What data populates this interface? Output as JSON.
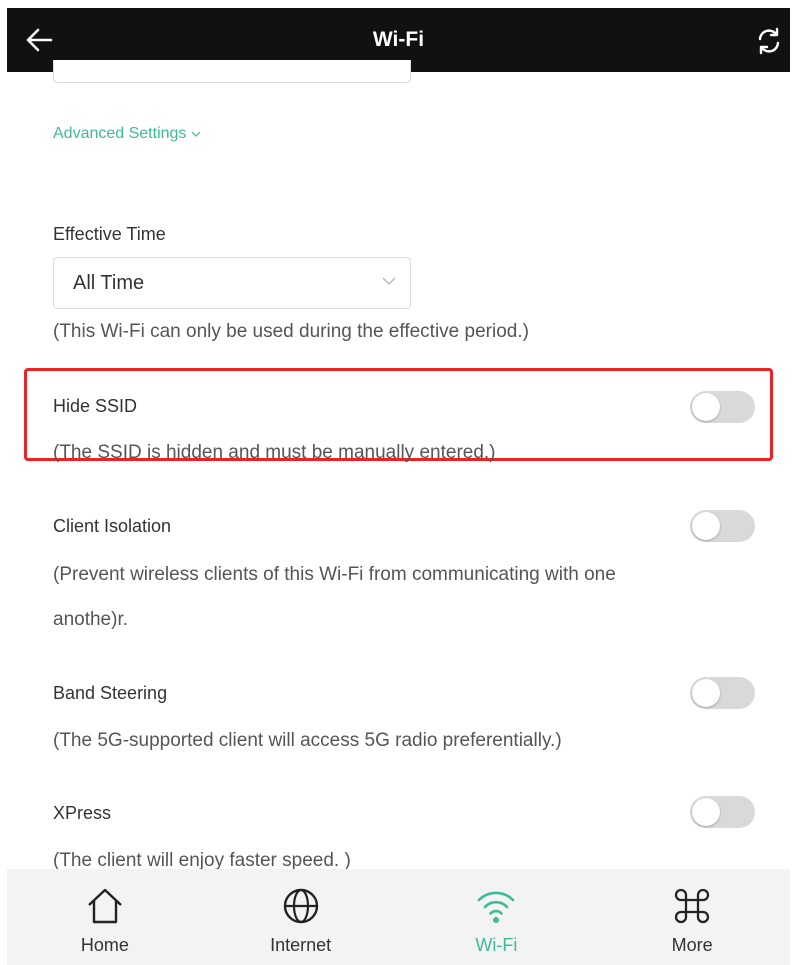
{
  "header": {
    "title": "Wi-Fi",
    "back_icon": "arrow-left-icon",
    "refresh_icon": "refresh-icon",
    "background": "#111111"
  },
  "advanced_settings": {
    "label": "Advanced Settings",
    "color": "#3fba98"
  },
  "effective_time": {
    "label": "Effective Time",
    "selected": "All Time",
    "description": "(This Wi-Fi can only be used during the effective period.)"
  },
  "settings": {
    "hide_ssid": {
      "label": "Hide SSID",
      "description": "(The SSID is hidden and must be manually entered.)",
      "enabled": false,
      "highlighted": true,
      "highlight_color": "#ee2222"
    },
    "client_isolation": {
      "label": "Client Isolation",
      "description_line1": "(Prevent wireless clients of this Wi-Fi from communicating with one",
      "description_line2": "anothe)r.",
      "enabled": false
    },
    "band_steering": {
      "label": "Band Steering",
      "description": "(The 5G-supported client will access 5G radio preferentially.)",
      "enabled": false
    },
    "xpress": {
      "label": "XPress",
      "description": "(The client will enjoy faster speed. )",
      "enabled": false
    }
  },
  "tabbar": {
    "tabs": [
      {
        "label": "Home",
        "icon": "home-icon",
        "active": false
      },
      {
        "label": "Internet",
        "icon": "globe-icon",
        "active": false
      },
      {
        "label": "Wi-Fi",
        "icon": "wifi-icon",
        "active": true
      },
      {
        "label": "More",
        "icon": "command-icon",
        "active": false
      }
    ],
    "active_color": "#3fba98"
  }
}
